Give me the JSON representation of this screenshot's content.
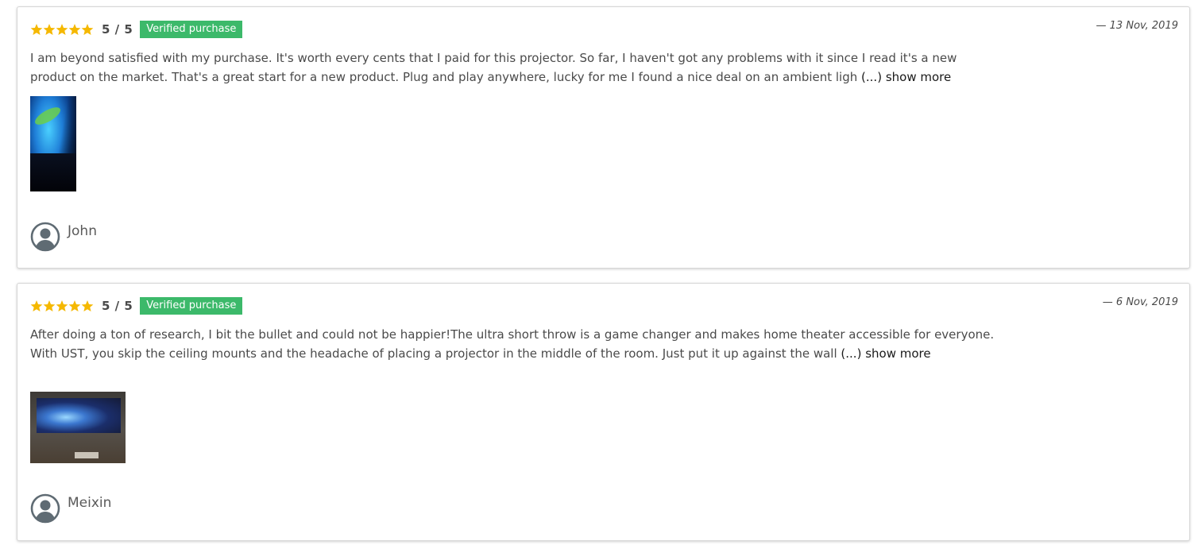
{
  "reviews": [
    {
      "rating": 5,
      "score_text": "5 / 5",
      "badge": "Verified purchase",
      "date": "— 13 Nov, 2019",
      "text": "I am beyond satisfied with my purchase. It's worth every cents that I paid for this projector. So far, I haven't got any problems with it since I read it's a new product on the market. That's a great start for a new product. Plug and play anywhere, lucky for me I found a nice deal on an ambient ligh",
      "show_more": "(...) show more",
      "author": "John"
    },
    {
      "rating": 5,
      "score_text": "5 / 5",
      "badge": "Verified purchase",
      "date": "— 6 Nov, 2019",
      "text": " After doing a ton of research, I bit the bullet and could not be happier!The ultra short throw is a game changer and makes home theater accessible for everyone. With UST, you skip the ceiling mounts and the headache of placing a projector in the middle of the room.  Just put it up against the wall",
      "show_more": "(...) show more",
      "author": "Meixin"
    }
  ],
  "colors": {
    "star": "#f5b800",
    "badge_bg": "#3cb96a",
    "text": "#4a4a4a",
    "avatar": "#5f6b73"
  },
  "icons": {
    "star": "star-icon",
    "avatar": "user-avatar-icon"
  }
}
